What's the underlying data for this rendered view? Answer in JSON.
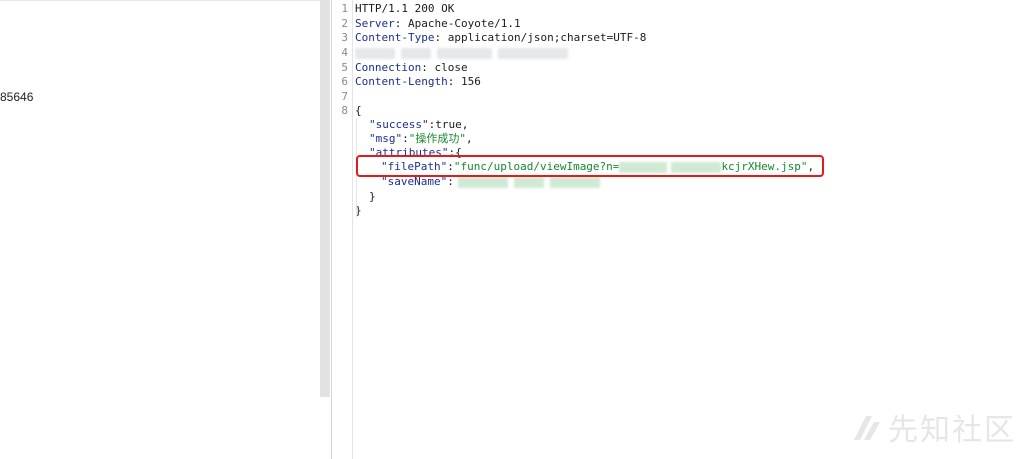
{
  "left_pane": {
    "fragment_text": "85646"
  },
  "editor": {
    "line_numbers": [
      "1",
      "2",
      "3",
      "4",
      "5",
      "6",
      "7",
      "8"
    ],
    "headers": [
      {
        "text": "HTTP/1.1 200 OK"
      },
      {
        "key": "Server",
        "value": "Apache-Coyote/1.1"
      },
      {
        "key": "Content-Type",
        "value": "application/json;charset=UTF-8"
      },
      {
        "key": "",
        "value": ""
      },
      {
        "key": "Connection",
        "value": "close"
      },
      {
        "key": "Content-Length",
        "value": "156"
      }
    ],
    "body": {
      "open_brace": "{",
      "success_key": "\"success\"",
      "success_value": "true,",
      "msg_key": "\"msg\"",
      "msg_value": "\"操作成功\"",
      "msg_comma": ",",
      "attributes_key": "\"attributes\"",
      "attributes_open": ":{",
      "filepath_key": "\"filePath\"",
      "filepath_value_start": "\"func/upload/viewImage?n=",
      "filepath_value_end": "kcjrXHew.jsp\"",
      "filepath_comma": ",",
      "savename_key": "\"saveName\"",
      "inner_close": "}",
      "close_brace": "}"
    }
  },
  "watermark": {
    "text": "先知社区",
    "logo_icon": "xianzhi-logo-icon"
  },
  "colors": {
    "highlight_border": "#e31b1b",
    "json_key": "#1b2f8f",
    "json_string": "#14892c"
  }
}
